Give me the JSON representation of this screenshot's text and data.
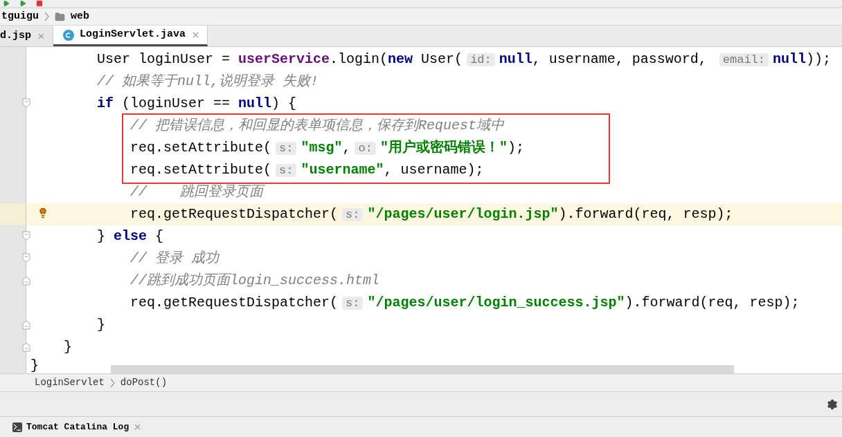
{
  "breadcrumb": [
    {
      "kind": "text",
      "text": "tguigu"
    },
    {
      "kind": "folder",
      "text": "web"
    }
  ],
  "tabs": [
    {
      "label": "d.jsp",
      "selected": false,
      "kind": "plain"
    },
    {
      "label": "LoginServlet.java",
      "selected": true,
      "kind": "class"
    }
  ],
  "code": [
    {
      "kind": "block",
      "children": [
        {
          "kind": "block",
          "children": [
            {
              "kind": "line",
              "tokens": [
                {
                  "kind": "plain",
                  "text": "User loginUser = "
                },
                {
                  "kind": "field",
                  "text": "userService"
                },
                {
                  "kind": "plain",
                  "text": ".login("
                },
                {
                  "kind": "keyword",
                  "text": "new"
                },
                {
                  "kind": "plain",
                  "text": " User("
                },
                {
                  "kind": "hint",
                  "text": "id:"
                },
                {
                  "kind": "keyword",
                  "text": "null"
                },
                {
                  "kind": "plain",
                  "text": ", username, password, "
                },
                {
                  "kind": "hint",
                  "text": "email:"
                },
                {
                  "kind": "keyword",
                  "text": "null"
                },
                {
                  "kind": "plain",
                  "text": "));"
                }
              ]
            },
            {
              "kind": "line",
              "tokens": [
                {
                  "kind": "comment",
                  "text": "// 如果等于null,说明登录 失败!"
                }
              ]
            },
            {
              "kind": "line",
              "fold_start": true,
              "tokens": [
                {
                  "kind": "keyword",
                  "text": "if"
                },
                {
                  "kind": "plain",
                  "text": " (loginUser == "
                },
                {
                  "kind": "keyword",
                  "text": "null"
                },
                {
                  "kind": "plain",
                  "text": ") {"
                }
              ],
              "children": [
                {
                  "kind": "annotation",
                  "children": [
                    {
                      "kind": "line",
                      "tokens": [
                        {
                          "kind": "comment",
                          "text": "// 把错误信息，和回显的表单项信息，保存到Request域中"
                        }
                      ]
                    },
                    {
                      "kind": "line",
                      "tokens": [
                        {
                          "kind": "plain",
                          "text": "req.setAttribute("
                        },
                        {
                          "kind": "hint",
                          "text": "s:"
                        },
                        {
                          "kind": "string",
                          "text": "\"msg\""
                        },
                        {
                          "kind": "plain",
                          "text": ","
                        },
                        {
                          "kind": "hint",
                          "text": "o:"
                        },
                        {
                          "kind": "string",
                          "text": "\"用户或密码错误！\""
                        },
                        {
                          "kind": "plain",
                          "text": ");"
                        }
                      ]
                    },
                    {
                      "kind": "line",
                      "tokens": [
                        {
                          "kind": "plain",
                          "text": "req.setAttribute("
                        },
                        {
                          "kind": "hint",
                          "text": "s:"
                        },
                        {
                          "kind": "string",
                          "text": "\"username\""
                        },
                        {
                          "kind": "plain",
                          "text": ", username);"
                        }
                      ]
                    }
                  ]
                },
                {
                  "kind": "line",
                  "tokens": [
                    {
                      "kind": "comment",
                      "text": "//    跳回登录页面"
                    }
                  ]
                },
                {
                  "kind": "line",
                  "current": true,
                  "tokens": [
                    {
                      "kind": "plain",
                      "text": "req.getRequestDispatcher("
                    },
                    {
                      "kind": "hint",
                      "text": "s:"
                    },
                    {
                      "kind": "string",
                      "text": "\"/pages/user/login.jsp\""
                    },
                    {
                      "kind": "plain",
                      "text": ").forward(req, resp);"
                    }
                  ]
                }
              ]
            },
            {
              "kind": "line",
              "fold_start": true,
              "tokens": [
                {
                  "kind": "plain",
                  "text": "} "
                },
                {
                  "kind": "keyword",
                  "text": "else"
                },
                {
                  "kind": "plain",
                  "text": " {"
                }
              ],
              "children": [
                {
                  "kind": "line",
                  "fold_start": true,
                  "tokens": [
                    {
                      "kind": "comment",
                      "text": "// 登录 成功"
                    }
                  ]
                },
                {
                  "kind": "line",
                  "fold_end": true,
                  "tokens": [
                    {
                      "kind": "comment",
                      "text": "//跳到成功页面login_success.html"
                    }
                  ]
                },
                {
                  "kind": "line",
                  "tokens": [
                    {
                      "kind": "plain",
                      "text": "req.getRequestDispatcher("
                    },
                    {
                      "kind": "hint",
                      "text": "s:"
                    },
                    {
                      "kind": "string",
                      "text": "\"/pages/user/login_success.jsp\""
                    },
                    {
                      "kind": "plain",
                      "text": ").forward(req, resp);"
                    }
                  ]
                }
              ]
            },
            {
              "kind": "line",
              "fold_end": true,
              "tokens": [
                {
                  "kind": "plain",
                  "text": "}"
                }
              ]
            }
          ]
        },
        {
          "kind": "line",
          "fold_end": true,
          "tokens": [
            {
              "kind": "plain",
              "text": "}"
            }
          ]
        }
      ]
    },
    {
      "kind": "line",
      "tokens": [
        {
          "kind": "plain",
          "text": "}"
        }
      ]
    }
  ],
  "structure_path": [
    "LoginServlet",
    "doPost()"
  ],
  "tool_tabs": [
    {
      "label": "Tomcat Catalina Log"
    }
  ]
}
